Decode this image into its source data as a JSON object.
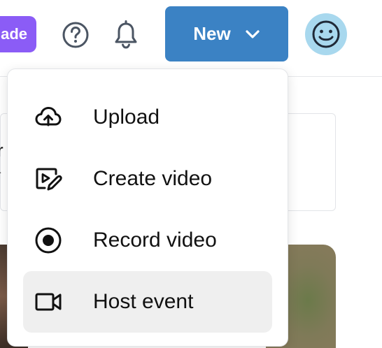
{
  "header": {
    "upgrade_label": "ade",
    "new_button_label": "New"
  },
  "icons": {
    "help": "help-circle-icon",
    "bell": "bell-icon",
    "chevron": "chevron-down-icon",
    "avatar": "smiley-avatar-icon"
  },
  "colors": {
    "upgrade": "#8b5cf6",
    "new_button": "#3b82c4",
    "avatar_bg": "#a8d8ee",
    "hover_bg": "#efefef"
  },
  "background": {
    "fragment_1": "r",
    "fragment_2": "-"
  },
  "menu": {
    "items": [
      {
        "label": "Upload",
        "icon": "cloud-upload-icon"
      },
      {
        "label": "Create video",
        "icon": "video-edit-icon"
      },
      {
        "label": "Record video",
        "icon": "record-icon"
      },
      {
        "label": "Host event",
        "icon": "video-camera-icon"
      }
    ]
  }
}
